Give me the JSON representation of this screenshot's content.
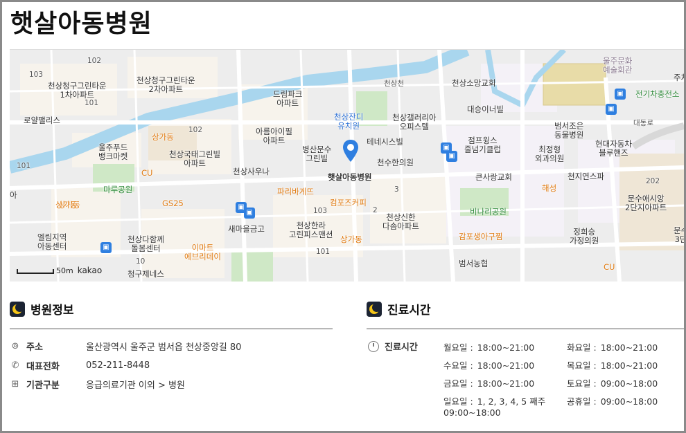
{
  "page": {
    "title": "햇살아동병원"
  },
  "map": {
    "scale_label": "50m",
    "provider": "kakao",
    "hospital_label": "햇살아동병원",
    "labels": [
      {
        "t": "102",
        "c": "num"
      },
      {
        "t": "103",
        "c": "num"
      },
      {
        "t": "천상청구그린타운\n1차아파트",
        "c": ""
      },
      {
        "t": "101",
        "c": "num"
      },
      {
        "t": "천상청구그린타운\n2차아파트",
        "c": ""
      },
      {
        "t": "로얄팰리스",
        "c": ""
      },
      {
        "t": "드림파크\n아파트",
        "c": ""
      },
      {
        "t": "아름아이필\n아파트",
        "c": ""
      },
      {
        "t": "102",
        "c": "num"
      },
      {
        "t": "상가동",
        "c": "orange"
      },
      {
        "t": "울주푸드\n뱅크마켓",
        "c": ""
      },
      {
        "t": "천상국태그린빌\n아파트",
        "c": ""
      },
      {
        "t": "CU",
        "c": "orange"
      },
      {
        "t": "101",
        "c": "num"
      },
      {
        "t": "마루공원",
        "c": "green"
      },
      {
        "t": "천상사우나",
        "c": ""
      },
      {
        "t": "GS25",
        "c": "orange"
      },
      {
        "t": "파리바게뜨",
        "c": "orange"
      },
      {
        "t": "상가동",
        "c": "orange"
      },
      {
        "t": "병산문수\n그린빌",
        "c": ""
      },
      {
        "t": "천상잔디\n유치원",
        "c": "blue"
      },
      {
        "t": "천상갤러리아\n오피스텔",
        "c": ""
      },
      {
        "t": "대승이너빌",
        "c": ""
      },
      {
        "t": "천상소망교회",
        "c": ""
      },
      {
        "t": "천상천",
        "c": "num"
      },
      {
        "t": "테네시스빌",
        "c": ""
      },
      {
        "t": "천수한의원",
        "c": ""
      },
      {
        "t": "컴포즈커피",
        "c": "orange"
      },
      {
        "t": "103",
        "c": "num"
      },
      {
        "t": "3",
        "c": "num"
      },
      {
        "t": "2",
        "c": "num"
      },
      {
        "t": "새마을금고",
        "c": ""
      },
      {
        "t": "천상한라\n고린피스맨션",
        "c": ""
      },
      {
        "t": "천상신한\n다솜아파트",
        "c": ""
      },
      {
        "t": "상가동",
        "c": "orange"
      },
      {
        "t": "엘림지역\n아동센터",
        "c": ""
      },
      {
        "t": "천상다함께\n돌봄센터",
        "c": ""
      },
      {
        "t": "이마트\n에브리데이",
        "c": "orange"
      },
      {
        "t": "101",
        "c": "num"
      },
      {
        "t": "10",
        "c": "num"
      },
      {
        "t": "청구제네스",
        "c": ""
      },
      {
        "t": "점프윙스\n줄넘기클럽",
        "c": ""
      },
      {
        "t": "큰사랑교회",
        "c": ""
      },
      {
        "t": "비나리공원",
        "c": "green"
      },
      {
        "t": "감포생아구찜",
        "c": "orange"
      },
      {
        "t": "범서농협",
        "c": ""
      },
      {
        "t": "범서조은\n동물병원",
        "c": ""
      },
      {
        "t": "최정형\n외과의원",
        "c": ""
      },
      {
        "t": "해성",
        "c": "orange"
      },
      {
        "t": "현대자동차\n블루핸즈",
        "c": ""
      },
      {
        "t": "천지연스파",
        "c": ""
      },
      {
        "t": "울주문화\n예술회관",
        "c": "dim"
      },
      {
        "t": "전기차충전소",
        "c": "green"
      },
      {
        "t": "주차",
        "c": ""
      },
      {
        "t": "202",
        "c": "num"
      },
      {
        "t": "문수애시앙\n2단지아파트",
        "c": ""
      },
      {
        "t": "정희승\n가정의원",
        "c": ""
      },
      {
        "t": "문수\n3단",
        "c": ""
      },
      {
        "t": "CU",
        "c": "orange"
      },
      {
        "t": "아",
        "c": ""
      },
      {
        "t": "상가동",
        "c": "orange"
      },
      {
        "t": "대동로",
        "c": "num"
      }
    ]
  },
  "info": {
    "title": "병원정보",
    "rows": [
      {
        "icon": "location-pin-icon",
        "key": "주소",
        "value": "울산광역시 울주군 범서읍 천상중앙길 80"
      },
      {
        "icon": "phone-icon",
        "key": "대표전화",
        "value": "052-211-8448"
      },
      {
        "icon": "hospital-icon",
        "key": "기관구분",
        "value": "응급의료기관 이외 > 병원"
      }
    ]
  },
  "hours": {
    "title": "진료시간",
    "key": "진료시간",
    "days": [
      {
        "day": "월요일 :",
        "time": "18:00~21:00"
      },
      {
        "day": "화요일 :",
        "time": "18:00~21:00"
      },
      {
        "day": "수요일 :",
        "time": "18:00~21:00"
      },
      {
        "day": "목요일 :",
        "time": "18:00~21:00"
      },
      {
        "day": "금요일 :",
        "time": "18:00~21:00"
      },
      {
        "day": "토요일 :",
        "time": "09:00~18:00"
      },
      {
        "day": "일요일 :",
        "time": "1, 2, 3, 4, 5 째주"
      },
      {
        "day": "공휴일 :",
        "time": "09:00~18:00"
      }
    ],
    "sunday_extra": "09:00~18:00"
  },
  "colors": {
    "accent": "#2f7fe0",
    "moon": "#f5c518",
    "river": "#a9d6ee",
    "park": "#cfe8c6"
  }
}
